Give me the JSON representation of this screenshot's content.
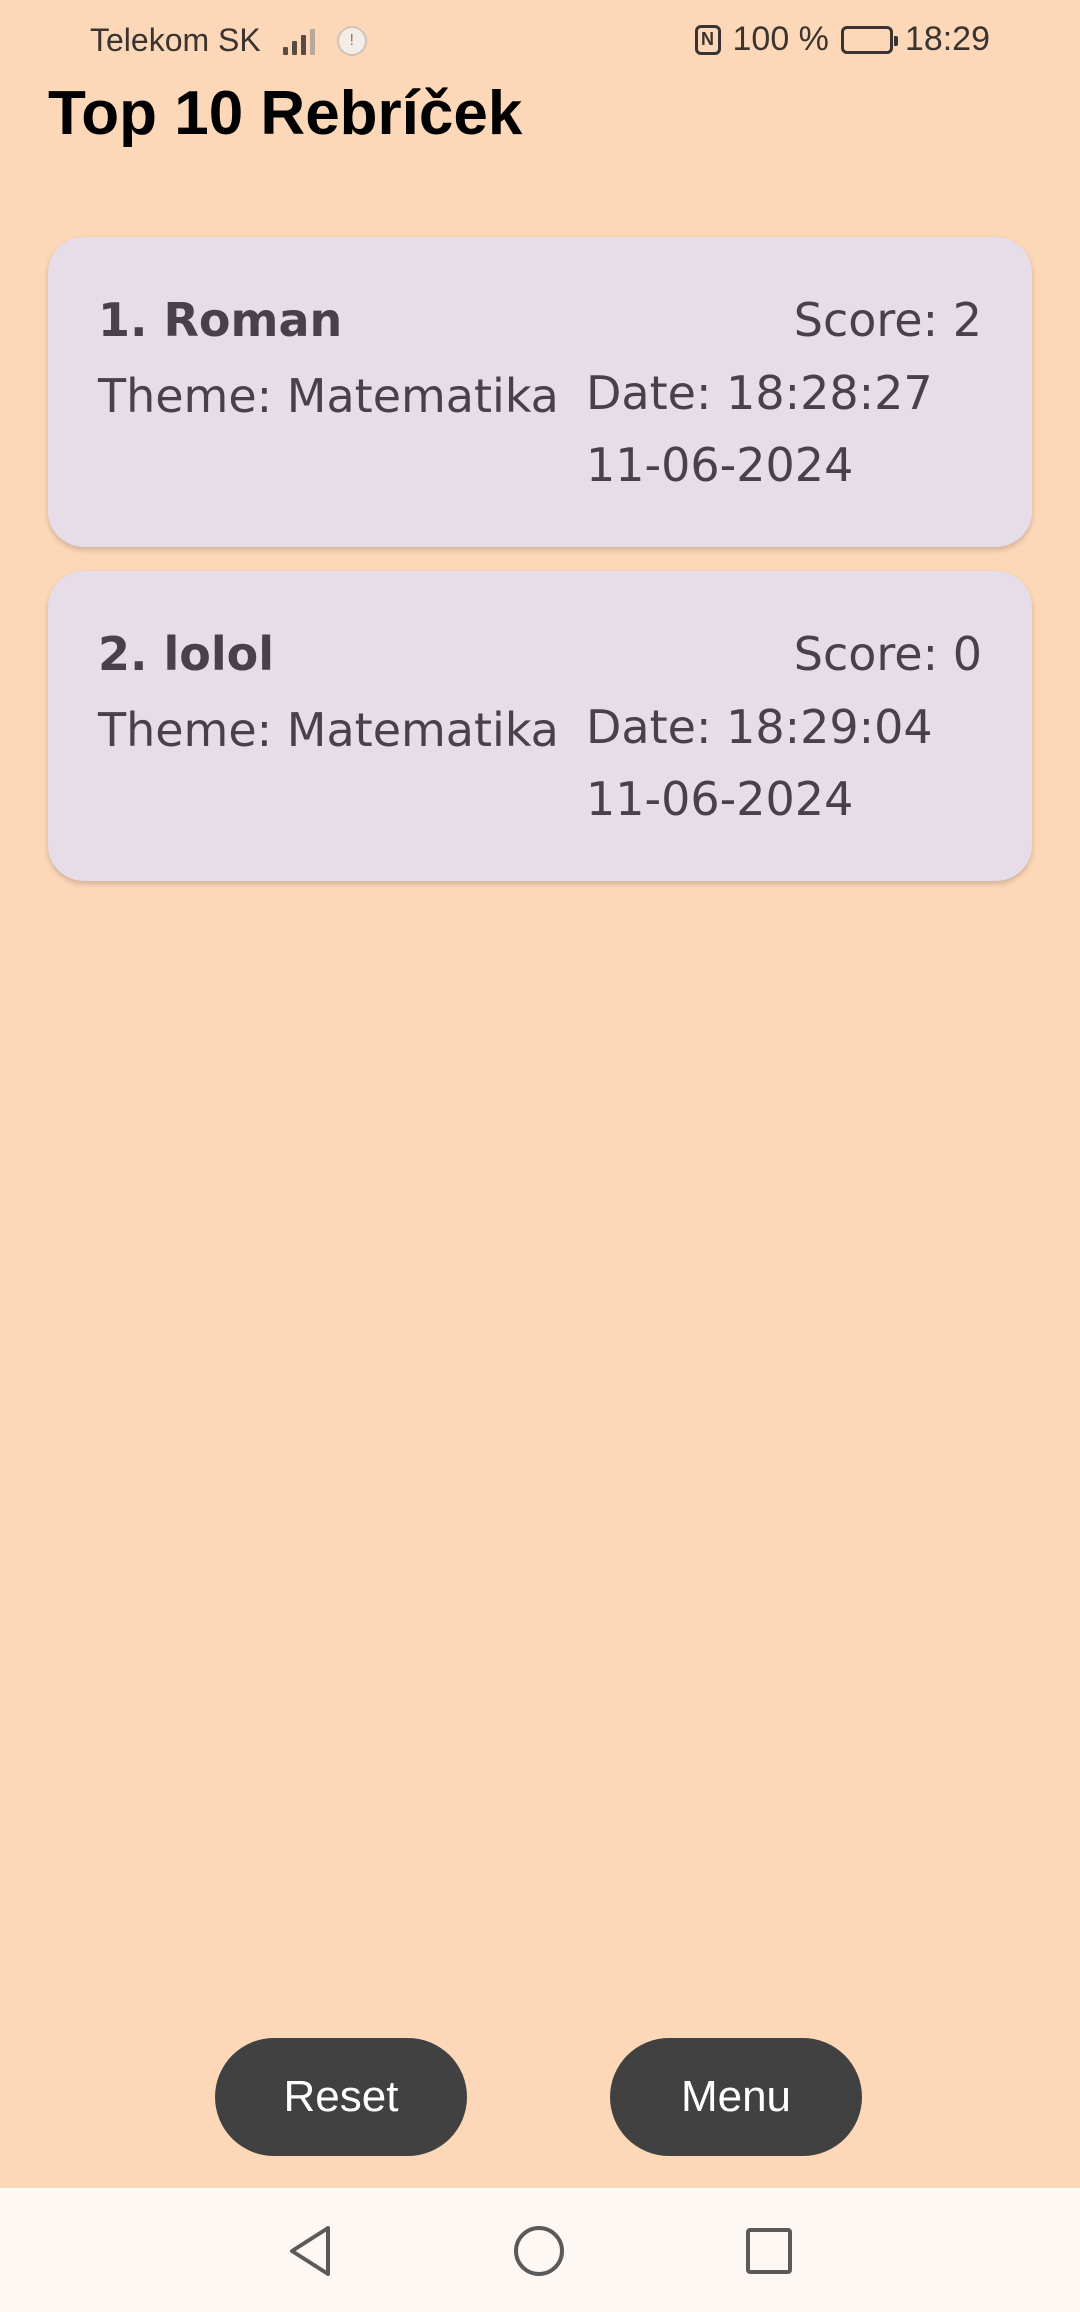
{
  "status_bar": {
    "carrier": "Telekom SK",
    "battery_percent": "100 %",
    "time": "18:29",
    "battery_level": 1.0,
    "icons": [
      "signal-icon",
      "hotspot-icon",
      "nfc-icon",
      "battery-icon"
    ]
  },
  "page": {
    "title": "Top 10 Rebríček"
  },
  "leaderboard": [
    {
      "name": "1. Roman",
      "score": "Score: 2",
      "theme": "Theme: Matematika",
      "date_time": "Date: 18:28:27",
      "date_day": "11-06-2024"
    },
    {
      "name": "2. lolol",
      "score": "Score: 0",
      "theme": "Theme: Matematika",
      "date_time": "Date: 18:29:04",
      "date_day": "11-06-2024"
    }
  ],
  "buttons": {
    "reset_label": "Reset",
    "menu_label": "Menu"
  },
  "navigation": {
    "icons": [
      "back-icon",
      "home-icon",
      "recent-apps-icon"
    ]
  },
  "colors": {
    "background": "#FDD8B8",
    "card": "#E6DDE9",
    "button": "#414141",
    "nav_bar": "#FEF8F4"
  }
}
